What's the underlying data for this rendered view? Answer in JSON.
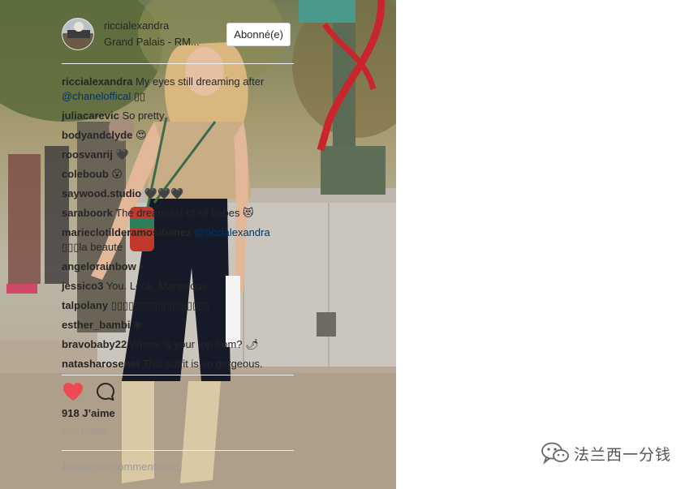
{
  "post": {
    "username": "riccialexandra",
    "location": "Grand Palais - RM...",
    "follow_label": "Abonné(e)",
    "likes": "918 J’aime",
    "date": "3 OCTOBRE",
    "comment_placeholder": "Ajouter un commentaire..."
  },
  "comments": [
    {
      "user": "riccialexandra",
      "text": " My eyes still dreaming after ",
      "mention": "@chaneloffical",
      "after": " ▯▯"
    },
    {
      "user": "juliacarevic",
      "text": " So pretty"
    },
    {
      "user": "bodyandclyde",
      "text": " 😍"
    },
    {
      "user": "roosvanrij",
      "text": " 🖤"
    },
    {
      "user": "coleboub",
      "text": " 😮"
    },
    {
      "user": "saywood.studio",
      "text": " 🖤🖤🖤"
    },
    {
      "user": "saraboork",
      "text": " The dreamiest of all babes 😻"
    },
    {
      "user": "marieclotilderamosibanez",
      "text": " ",
      "mention": "@riccialexandra",
      "after": " ▯▯▯la beauté"
    },
    {
      "user": "angelorainbow",
      "text": " ⭑"
    },
    {
      "user": "jessico3",
      "text": " You. Look. Marvelous"
    },
    {
      "user": "talpolany",
      "text": " ▯▯▯▯▯▯▯▯▯▯▯▯▯▯▯▯▯"
    },
    {
      "user": "esther_bambi",
      "text": " ✸"
    },
    {
      "user": "bravobaby22",
      "text": " Where is your top from? 🌶"
    },
    {
      "user": "natasharosenet",
      "text": " This outfit is so gorgeous."
    }
  ],
  "icons": {
    "like": "heart-icon",
    "comment": "comment-bubble-icon",
    "watermark": "wechat-icon"
  },
  "colors": {
    "like": "#ed4956",
    "mention": "#003569",
    "muted": "#999999"
  },
  "watermark": {
    "text": "法兰西一分钱"
  }
}
